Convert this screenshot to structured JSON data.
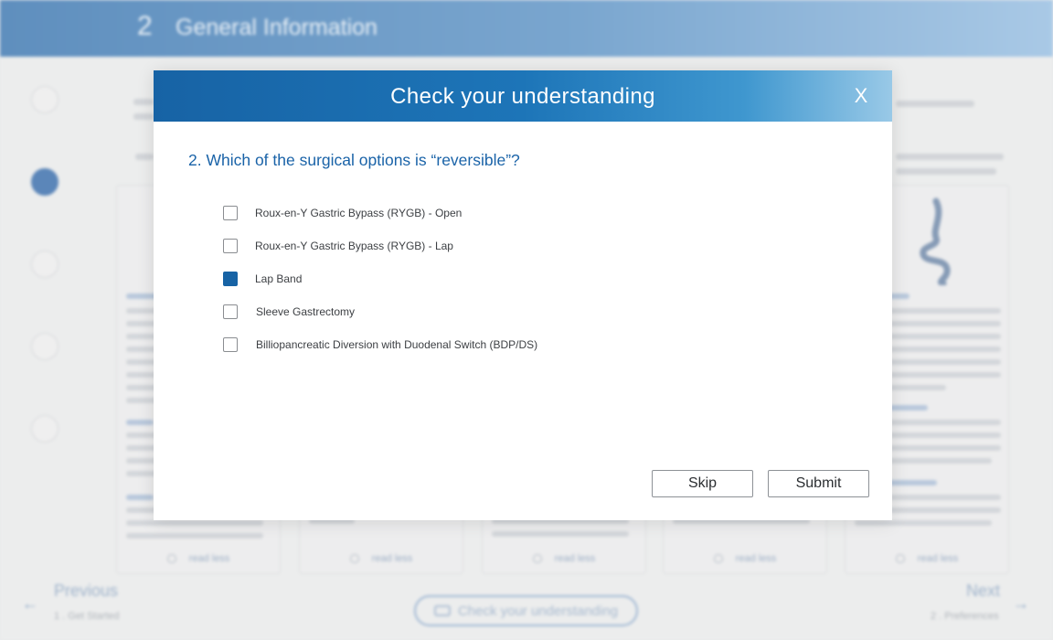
{
  "background": {
    "header_number": "2",
    "header_title": "General Information",
    "read_less_label": "read less",
    "nav": {
      "previous_label": "Previous",
      "previous_sub": "1 . Get Started",
      "next_label": "Next",
      "next_sub": "2 . Preferences"
    },
    "check_understanding_label": "Check your understanding"
  },
  "modal": {
    "title": "Check your understanding",
    "close_label": "X",
    "question": "2. Which of the surgical options is “reversible”?",
    "options": [
      {
        "label": "Roux-en-Y Gastric Bypass (RYGB) - Open",
        "checked": false
      },
      {
        "label": "Roux-en-Y Gastric Bypass (RYGB) - Lap",
        "checked": false
      },
      {
        "label": "Lap Band",
        "checked": true
      },
      {
        "label": "Sleeve Gastrectomy",
        "checked": false
      },
      {
        "label": "Billiopancreatic Diversion with Duodenal Switch (BDP/DS)",
        "checked": false
      }
    ],
    "skip_label": "Skip",
    "submit_label": "Submit"
  },
  "colors": {
    "accent": "#1763a5",
    "checkbox_checked": "#1763a5"
  }
}
